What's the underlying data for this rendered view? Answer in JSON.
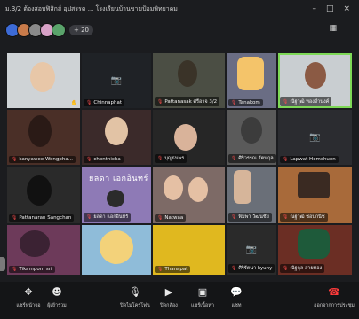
{
  "window": {
    "title": "ม.3/2 ต้องสอบฟิสิกส์ อุปสรรค ... โรงเรียนบ้านขามป้อมพิทยาคม",
    "minimize": "–",
    "maximize": "□",
    "close": "×"
  },
  "participants": {
    "count_label": "+ 20",
    "avatar_colors": [
      "#3d6bd6",
      "#c97b4a",
      "#8a8a8a",
      "#d8a2c7",
      "#5aa36b"
    ]
  },
  "tiles": [
    {
      "name": "",
      "icons": "🔒 ✋",
      "color": "#cfd3d6",
      "kind": "video"
    },
    {
      "name": "Chinnaphat",
      "color": "#1f2226",
      "kind": "camoff"
    },
    {
      "name": "Pattanasak ศรีอาจ 3/2",
      "color": "#4b4e44",
      "kind": "video"
    },
    {
      "name": "Tanakom",
      "color": "#6a6d84",
      "kind": "video"
    },
    {
      "name": "ณัฐวุฒิ ทองจำนงค์",
      "color": "#c9ced1",
      "kind": "video",
      "highlight": true
    },
    {
      "name": "kanyawee Wongpha...",
      "color": "#4a2f27",
      "kind": "video"
    },
    {
      "name": "chonthicha",
      "color": "#3b2a2a",
      "kind": "video"
    },
    {
      "name": "บุญธนพร",
      "color": "#262626",
      "kind": "video"
    },
    {
      "name": "ศิริวรรณ รัตนกุล",
      "color": "#5a5a5a",
      "kind": "video"
    },
    {
      "name": "Lapwat Homchuen",
      "color": "#2b2c30",
      "kind": "camoff"
    },
    {
      "name": "Pattanaran Sangchan",
      "color": "#2a2a2a",
      "kind": "video"
    },
    {
      "name": "ยลดา แอกอินทร์",
      "color": "#8e7ab6",
      "kind": "video",
      "overlay": "ยลดา เอกอินทร์"
    },
    {
      "name": "Natwaa",
      "color": "#7d6a66",
      "kind": "video"
    },
    {
      "name": "พิมพา วัฒนชัย",
      "color": "#6a6f78",
      "kind": "video"
    },
    {
      "name": "ณฐวุฒิ ชอบกนิช",
      "color": "#a86a3a",
      "kind": "video"
    },
    {
      "name": "Tikampom sri",
      "color": "#6d3a5a",
      "kind": "video"
    },
    {
      "name": "",
      "color": "#8fbcd9",
      "kind": "video"
    },
    {
      "name": "Thanapat",
      "color": "#e0b81f",
      "kind": "video"
    },
    {
      "name": "ศิริรัตนา kyuhy",
      "color": "#2a2a2a",
      "kind": "camoff"
    },
    {
      "name": "ณัฐกุล สายทอง",
      "color": "#6b2e24",
      "kind": "video"
    }
  ],
  "toolbar": {
    "items": [
      {
        "label": "แชร์หน้าจอ",
        "icon": "✥"
      },
      {
        "label": "ผู้เข้าร่วม",
        "icon": "☻"
      },
      {
        "label": "ปิดไมโครโฟน",
        "icon": "🎙"
      },
      {
        "label": "ปิดกล้อง",
        "icon": "▶"
      },
      {
        "label": "แชร์เนื้อหา",
        "icon": "▣"
      },
      {
        "label": "แชท",
        "icon": "💬"
      },
      {
        "label": "ออกจากการประชุม",
        "icon": "☎"
      }
    ]
  }
}
